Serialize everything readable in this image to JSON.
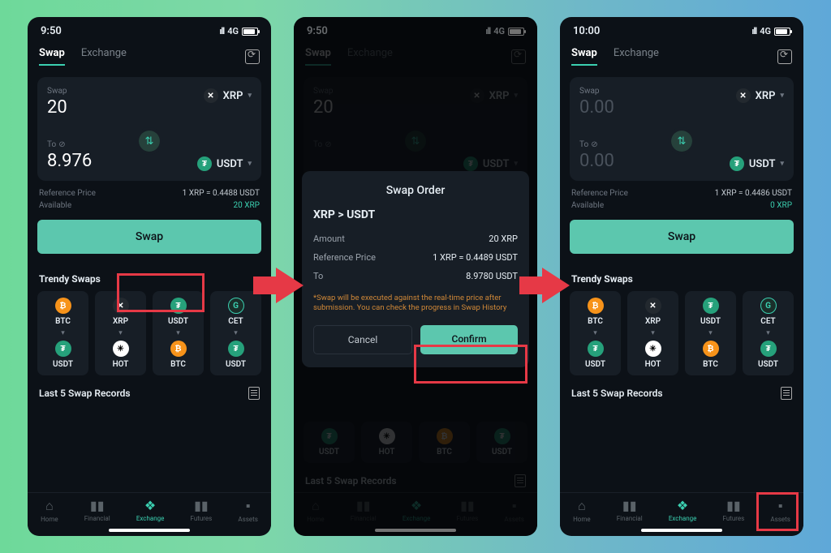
{
  "screens": [
    {
      "status": {
        "time": "9:50",
        "network": "4G"
      },
      "tabs": {
        "swap": "Swap",
        "exchange": "Exchange"
      },
      "swap_card": {
        "swap_label": "Swap",
        "swap_amount": "20",
        "from_coin": "XRP",
        "to_label": "To",
        "to_amount": "8.976",
        "to_coin": "USDT"
      },
      "ref_price": {
        "label": "Reference Price",
        "value": "1 XRP  =  0.4488 USDT"
      },
      "available": {
        "label": "Available",
        "value": "20 XRP"
      },
      "swap_btn": "Swap",
      "trendy_title": "Trendy Swaps",
      "trendy": [
        {
          "from": "BTC",
          "to": "USDT",
          "fi": "btc",
          "ti": "usdt"
        },
        {
          "from": "XRP",
          "to": "HOT",
          "fi": "xrp",
          "ti": "hot"
        },
        {
          "from": "USDT",
          "to": "BTC",
          "fi": "usdt",
          "ti": "btc"
        },
        {
          "from": "CET",
          "to": "USDT",
          "fi": "cet",
          "ti": "usdt"
        }
      ],
      "records_title": "Last 5 Swap Records",
      "nav": [
        "Home",
        "Financial",
        "Exchange",
        "Futures",
        "Assets"
      ]
    },
    {
      "status": {
        "time": "9:50",
        "network": "4G"
      },
      "tabs": {
        "swap": "Swap",
        "exchange": "Exchange"
      },
      "swap_card": {
        "swap_label": "Swap",
        "swap_amount": "20",
        "from_coin": "XRP",
        "to_label": "To",
        "to_amount": "",
        "to_coin": "USDT"
      },
      "records_title": "Last 5 Swap Records",
      "trendy": [
        {
          "from": "USDT",
          "fi": "usdt"
        },
        {
          "from": "HOT",
          "fi": "hot"
        },
        {
          "from": "BTC",
          "fi": "btc"
        },
        {
          "from": "USDT",
          "fi": "usdt"
        }
      ],
      "nav": [
        "Home",
        "Financial",
        "Exchange",
        "Futures",
        "Assets"
      ],
      "modal": {
        "title": "Swap Order",
        "pair": "XRP > USDT",
        "rows": [
          {
            "k": "Amount",
            "v": "20 XRP"
          },
          {
            "k": "Reference Price",
            "v": "1 XRP  =  0.4489 USDT"
          },
          {
            "k": "To",
            "v": "8.9780 USDT"
          }
        ],
        "note": "*Swap will be executed against the real-time price after submission. You can check the progress in Swap History",
        "cancel": "Cancel",
        "confirm": "Confirm"
      }
    },
    {
      "status": {
        "time": "10:00",
        "network": "4G"
      },
      "tabs": {
        "swap": "Swap",
        "exchange": "Exchange"
      },
      "swap_card": {
        "swap_label": "Swap",
        "swap_amount": "0.00",
        "from_coin": "XRP",
        "to_label": "To",
        "to_amount": "0.00",
        "to_coin": "USDT"
      },
      "ref_price": {
        "label": "Reference Price",
        "value": "1 XRP  =  0.4486 USDT"
      },
      "available": {
        "label": "Available",
        "value": "0 XRP"
      },
      "swap_btn": "Swap",
      "trendy_title": "Trendy Swaps",
      "trendy": [
        {
          "from": "BTC",
          "to": "USDT",
          "fi": "btc",
          "ti": "usdt"
        },
        {
          "from": "XRP",
          "to": "HOT",
          "fi": "xrp",
          "ti": "hot"
        },
        {
          "from": "USDT",
          "to": "BTC",
          "fi": "usdt",
          "ti": "btc"
        },
        {
          "from": "CET",
          "to": "USDT",
          "fi": "cet",
          "ti": "usdt"
        }
      ],
      "records_title": "Last 5 Swap Records",
      "nav": [
        "Home",
        "Financial",
        "Exchange",
        "Futures",
        "Assets"
      ]
    }
  ]
}
